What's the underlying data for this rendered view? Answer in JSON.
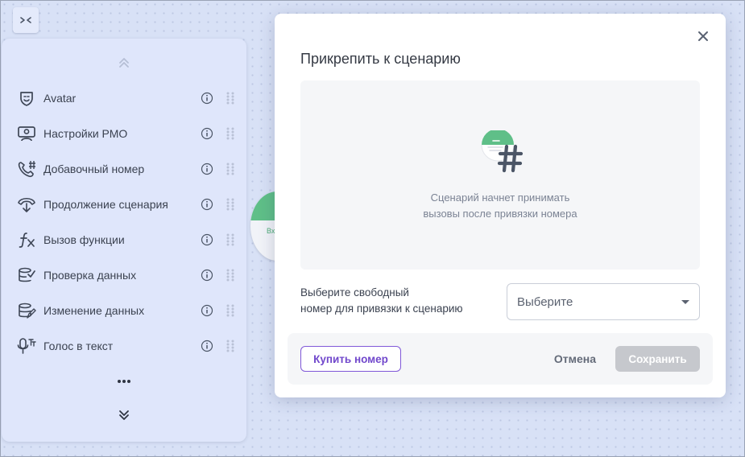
{
  "colors": {
    "accent": "#7148cc",
    "node_green": "#5fbf88",
    "sidebar_bg": "#dfe6fb",
    "canvas_bg": "#d8e1f6",
    "disabled_button": "#c6c8cd"
  },
  "toolbar": {
    "collapse_icon": "collapse-arrows-icon"
  },
  "sidebar": {
    "scroll_up_icon": "double-chevron-up-icon",
    "items": [
      {
        "label": "Avatar",
        "icon": "avatar-mask-icon"
      },
      {
        "label": "Настройки РМО",
        "icon": "operator-settings-icon"
      },
      {
        "label": "Добавочный номер",
        "icon": "phone-extension-icon"
      },
      {
        "label": "Продолжение сценария",
        "icon": "scenario-continue-icon"
      },
      {
        "label": "Вызов функции",
        "icon": "function-fx-icon"
      },
      {
        "label": "Проверка данных",
        "icon": "data-check-icon"
      },
      {
        "label": "Изменение данных",
        "icon": "data-edit-icon"
      },
      {
        "label": "Голос в текст",
        "icon": "voice-to-text-icon"
      }
    ],
    "more_icon": "more-dots-icon",
    "scroll_down_icon": "double-chevron-down-icon"
  },
  "canvas": {
    "node_text": "Вх"
  },
  "modal": {
    "title": "Прикрепить к сценарию",
    "close_icon": "close-icon",
    "preview": {
      "icon": "scenario-hash-icon",
      "text_line1": "Сценарий начнет принимать",
      "text_line2": "вызовы после привязки номера"
    },
    "select": {
      "label_line1": "Выберите свободный",
      "label_line2": "номер для привязки к сценарию",
      "value": "Выберите"
    },
    "buttons": {
      "buy": "Купить номер",
      "cancel": "Отмена",
      "save": "Сохранить"
    }
  }
}
